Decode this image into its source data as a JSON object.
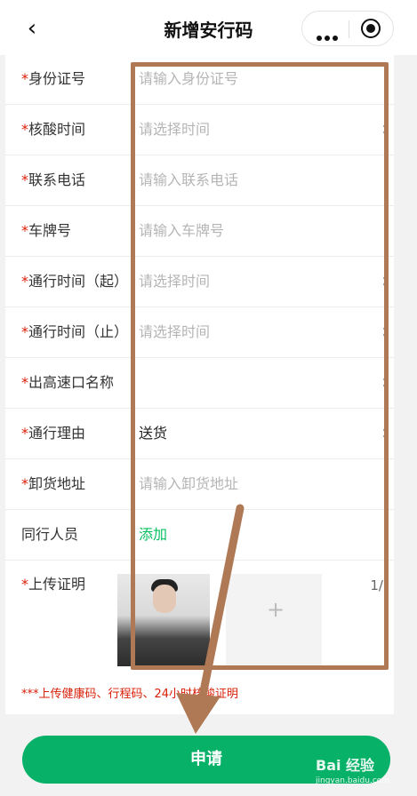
{
  "nav": {
    "title": "新增安行码",
    "back_icon": "chevron-left-icon",
    "more_icon": "more-dots-icon",
    "close_icon": "target-circle-icon"
  },
  "required_mark": "*",
  "form": {
    "rows": [
      {
        "label": "身份证号",
        "required": true,
        "value": "请输入身份证号",
        "state": "placeholder",
        "chevron": false
      },
      {
        "label": "核酸时间",
        "required": true,
        "value": "请选择时间",
        "state": "placeholder",
        "chevron": true
      },
      {
        "label": "联系电话",
        "required": true,
        "value": "请输入联系电话",
        "state": "placeholder",
        "chevron": false
      },
      {
        "label": "车牌号",
        "required": true,
        "value": "请输入车牌号",
        "state": "placeholder",
        "chevron": false
      },
      {
        "label": "通行时间（起）",
        "required": true,
        "value": "请选择时间",
        "state": "placeholder",
        "chevron": true
      },
      {
        "label": "通行时间（止）",
        "required": true,
        "value": "请选择时间",
        "state": "placeholder",
        "chevron": true
      },
      {
        "label": "出高速口名称",
        "required": true,
        "value": "",
        "state": "placeholder",
        "chevron": true
      },
      {
        "label": "通行理由",
        "required": true,
        "value": "送货",
        "state": "filled",
        "chevron": true
      },
      {
        "label": "卸货地址",
        "required": true,
        "value": "请输入卸货地址",
        "state": "placeholder",
        "chevron": false
      },
      {
        "label": "同行人员",
        "required": false,
        "value": "添加",
        "state": "link",
        "chevron": false
      }
    ],
    "upload": {
      "label": "上传证明",
      "count": "1/",
      "add_icon": "plus-icon"
    },
    "tip": "***上传健康码、行程码、24小时核酸证明"
  },
  "submit_label": "申请",
  "watermark": {
    "text": "Bai 经验",
    "sub": "jingyan.baidu.com"
  },
  "colors": {
    "accent": "#07b168",
    "required": "#d81e06",
    "annotation": "#b07956"
  }
}
